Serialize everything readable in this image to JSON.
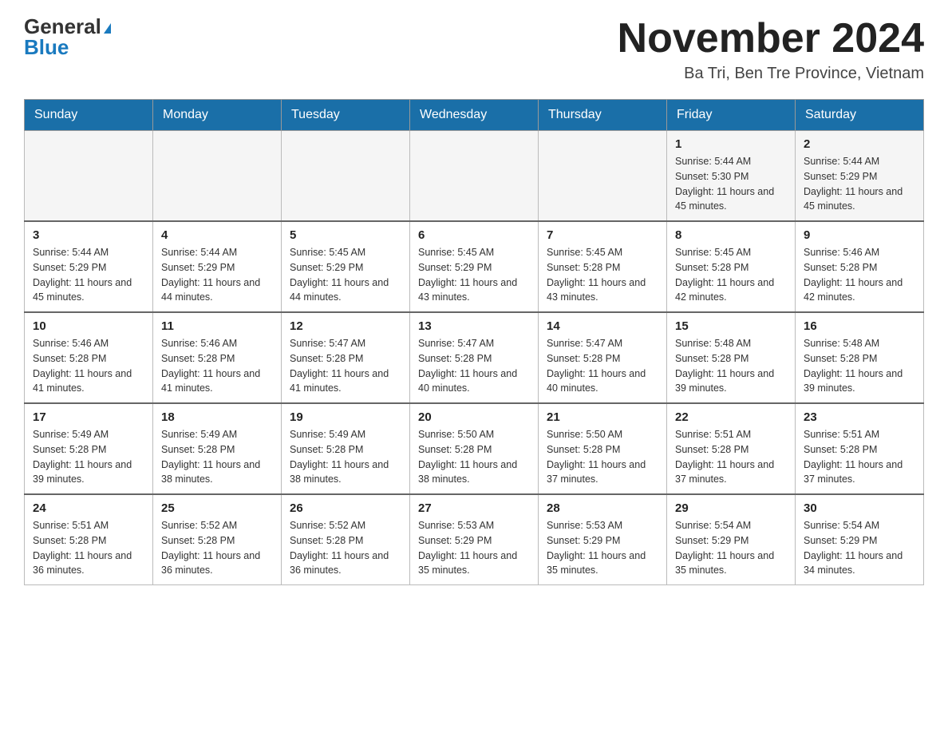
{
  "header": {
    "logo_general": "General",
    "logo_blue": "Blue",
    "month_year": "November 2024",
    "location": "Ba Tri, Ben Tre Province, Vietnam"
  },
  "weekdays": [
    "Sunday",
    "Monday",
    "Tuesday",
    "Wednesday",
    "Thursday",
    "Friday",
    "Saturday"
  ],
  "weeks": [
    [
      {
        "day": "",
        "info": ""
      },
      {
        "day": "",
        "info": ""
      },
      {
        "day": "",
        "info": ""
      },
      {
        "day": "",
        "info": ""
      },
      {
        "day": "",
        "info": ""
      },
      {
        "day": "1",
        "info": "Sunrise: 5:44 AM\nSunset: 5:30 PM\nDaylight: 11 hours and 45 minutes."
      },
      {
        "day": "2",
        "info": "Sunrise: 5:44 AM\nSunset: 5:29 PM\nDaylight: 11 hours and 45 minutes."
      }
    ],
    [
      {
        "day": "3",
        "info": "Sunrise: 5:44 AM\nSunset: 5:29 PM\nDaylight: 11 hours and 45 minutes."
      },
      {
        "day": "4",
        "info": "Sunrise: 5:44 AM\nSunset: 5:29 PM\nDaylight: 11 hours and 44 minutes."
      },
      {
        "day": "5",
        "info": "Sunrise: 5:45 AM\nSunset: 5:29 PM\nDaylight: 11 hours and 44 minutes."
      },
      {
        "day": "6",
        "info": "Sunrise: 5:45 AM\nSunset: 5:29 PM\nDaylight: 11 hours and 43 minutes."
      },
      {
        "day": "7",
        "info": "Sunrise: 5:45 AM\nSunset: 5:28 PM\nDaylight: 11 hours and 43 minutes."
      },
      {
        "day": "8",
        "info": "Sunrise: 5:45 AM\nSunset: 5:28 PM\nDaylight: 11 hours and 42 minutes."
      },
      {
        "day": "9",
        "info": "Sunrise: 5:46 AM\nSunset: 5:28 PM\nDaylight: 11 hours and 42 minutes."
      }
    ],
    [
      {
        "day": "10",
        "info": "Sunrise: 5:46 AM\nSunset: 5:28 PM\nDaylight: 11 hours and 41 minutes."
      },
      {
        "day": "11",
        "info": "Sunrise: 5:46 AM\nSunset: 5:28 PM\nDaylight: 11 hours and 41 minutes."
      },
      {
        "day": "12",
        "info": "Sunrise: 5:47 AM\nSunset: 5:28 PM\nDaylight: 11 hours and 41 minutes."
      },
      {
        "day": "13",
        "info": "Sunrise: 5:47 AM\nSunset: 5:28 PM\nDaylight: 11 hours and 40 minutes."
      },
      {
        "day": "14",
        "info": "Sunrise: 5:47 AM\nSunset: 5:28 PM\nDaylight: 11 hours and 40 minutes."
      },
      {
        "day": "15",
        "info": "Sunrise: 5:48 AM\nSunset: 5:28 PM\nDaylight: 11 hours and 39 minutes."
      },
      {
        "day": "16",
        "info": "Sunrise: 5:48 AM\nSunset: 5:28 PM\nDaylight: 11 hours and 39 minutes."
      }
    ],
    [
      {
        "day": "17",
        "info": "Sunrise: 5:49 AM\nSunset: 5:28 PM\nDaylight: 11 hours and 39 minutes."
      },
      {
        "day": "18",
        "info": "Sunrise: 5:49 AM\nSunset: 5:28 PM\nDaylight: 11 hours and 38 minutes."
      },
      {
        "day": "19",
        "info": "Sunrise: 5:49 AM\nSunset: 5:28 PM\nDaylight: 11 hours and 38 minutes."
      },
      {
        "day": "20",
        "info": "Sunrise: 5:50 AM\nSunset: 5:28 PM\nDaylight: 11 hours and 38 minutes."
      },
      {
        "day": "21",
        "info": "Sunrise: 5:50 AM\nSunset: 5:28 PM\nDaylight: 11 hours and 37 minutes."
      },
      {
        "day": "22",
        "info": "Sunrise: 5:51 AM\nSunset: 5:28 PM\nDaylight: 11 hours and 37 minutes."
      },
      {
        "day": "23",
        "info": "Sunrise: 5:51 AM\nSunset: 5:28 PM\nDaylight: 11 hours and 37 minutes."
      }
    ],
    [
      {
        "day": "24",
        "info": "Sunrise: 5:51 AM\nSunset: 5:28 PM\nDaylight: 11 hours and 36 minutes."
      },
      {
        "day": "25",
        "info": "Sunrise: 5:52 AM\nSunset: 5:28 PM\nDaylight: 11 hours and 36 minutes."
      },
      {
        "day": "26",
        "info": "Sunrise: 5:52 AM\nSunset: 5:28 PM\nDaylight: 11 hours and 36 minutes."
      },
      {
        "day": "27",
        "info": "Sunrise: 5:53 AM\nSunset: 5:29 PM\nDaylight: 11 hours and 35 minutes."
      },
      {
        "day": "28",
        "info": "Sunrise: 5:53 AM\nSunset: 5:29 PM\nDaylight: 11 hours and 35 minutes."
      },
      {
        "day": "29",
        "info": "Sunrise: 5:54 AM\nSunset: 5:29 PM\nDaylight: 11 hours and 35 minutes."
      },
      {
        "day": "30",
        "info": "Sunrise: 5:54 AM\nSunset: 5:29 PM\nDaylight: 11 hours and 34 minutes."
      }
    ]
  ]
}
